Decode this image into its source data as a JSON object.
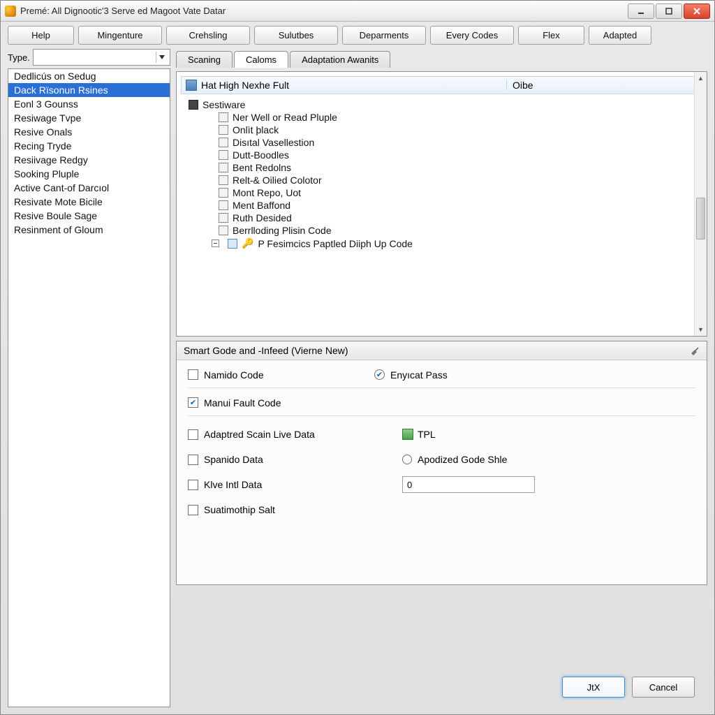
{
  "window": {
    "title": "Premé: All Dignootic'3 Serve ed Magoot Vate Datar"
  },
  "toolbar": [
    "Help",
    "Mingenture",
    "Crehsling",
    "Sulutbes",
    "Deparments",
    "Every Codes",
    "Flex",
    "Adapted"
  ],
  "type_label": "Type.",
  "sidebar": {
    "items": [
      "Dedlicús on Sedug",
      "Dack Rïsonun Rsines",
      "Eonl 3 Gounss",
      "Resiwage Tvpe",
      "Resive Onals",
      "Recing Tryde",
      "Resiivage Redgy",
      "Sooking Pluple",
      "Active Cant-of Darcıol",
      "Resivate Mote Bicile",
      "Resive Boule Sage",
      "Resinment of Gloum"
    ],
    "selected_index": 1
  },
  "tabs": {
    "items": [
      "Scaning",
      "Caloms",
      "Adaptation Awanits"
    ],
    "active_index": 1
  },
  "tree": {
    "header_left": "Hat High Nexhe Fult",
    "header_right": "Oibe",
    "root": "Sestiware",
    "children": [
      "Ner Well or Read Pluple",
      "Onlìt þlack",
      "Disıtal Vasellestion",
      "Dutt-Boodles",
      "Bent Redolns",
      "Relt-& Oilied Colotor",
      "Mont Repo, Uot",
      "Ment Baffond",
      "Ruth Desided",
      "Berrlloding Plisin Code"
    ],
    "branch": "P Fesimcics Paptled Diiph Up Code"
  },
  "form": {
    "header": "Smart Gode and -Infeed (Vierne New)",
    "namido": "Namido Code",
    "enycat": "Enyıcat Pass",
    "manui": "Manui Fault Code",
    "adaptred": "Adaptred Scain Live Data",
    "tpl": "TPL",
    "spanido": "Spanido Data",
    "apodized": "Apodized Gode Shle",
    "klve": "Klve Intl Data",
    "klve_value": "0",
    "suatimothip": "Suatimothip Salt"
  },
  "footer": {
    "ok": "JtX",
    "cancel": "Cancel"
  }
}
